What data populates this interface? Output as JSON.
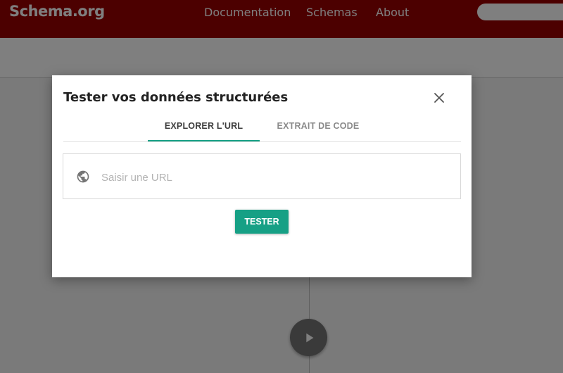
{
  "site": {
    "logo": "Schema.org",
    "nav": [
      "Documentation",
      "Schemas",
      "About"
    ]
  },
  "dialog": {
    "title": "Tester vos données structurées",
    "tabs": [
      {
        "label": "Explorer l'URL",
        "active": true
      },
      {
        "label": "Extrait de code",
        "active": false
      }
    ],
    "url_placeholder": "Saisir une URL",
    "submit_label": "Tester"
  },
  "icons": {
    "close": "close-icon",
    "globe": "globe-icon",
    "play": "play-icon"
  },
  "colors": {
    "navbar": "#990000",
    "accent": "#16a085",
    "fab": "#757575"
  }
}
